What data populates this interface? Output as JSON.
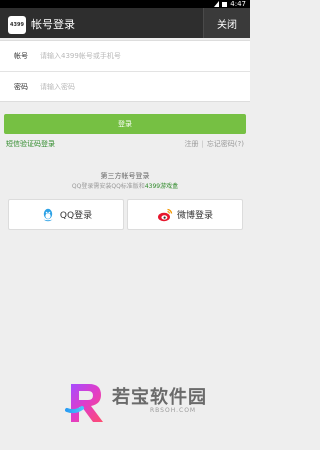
{
  "status_bar": {
    "time": "4:47"
  },
  "header": {
    "title": "帐号登录",
    "close_label": "关闭",
    "logo_text": "4399"
  },
  "form": {
    "account_label": "帐号",
    "account_placeholder": "请输入4399帐号或手机号",
    "password_label": "密码",
    "password_placeholder": "请输入密码"
  },
  "login_button": "登录",
  "links": {
    "sms_login": "短信验证码登录",
    "register": "注册",
    "separator": "|",
    "forgot_password": "忘记密码(?)"
  },
  "third_party": {
    "title": "第三方帐号登录",
    "tip_prefix": "QQ登录需安装QQ标准版和",
    "tip_link": "4399游戏盒",
    "qq_label": "QQ登录",
    "weibo_label": "微博登录"
  },
  "watermark": {
    "name": "若宝软件园",
    "url": "RBSOH.COM"
  },
  "colors": {
    "accent": "#76c043",
    "link_green": "#2f8a2a",
    "header_bg": "#2e2e2e",
    "qq_blue": "#2ea2e6",
    "weibo_red": "#e6162d"
  }
}
